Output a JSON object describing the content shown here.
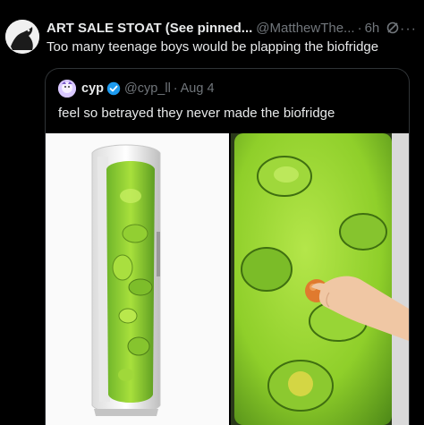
{
  "tweet": {
    "display_name": "ART SALE STOAT (See pinned...",
    "handle": "@MatthewThe...",
    "separator": "·",
    "time": "6h",
    "text": "Too many teenage boys would be plapping the biofridge",
    "more": "···"
  },
  "quoted": {
    "display_name": "cyp",
    "handle": "@cyp_ll",
    "separator": "·",
    "date": "Aug 4",
    "text": "feel so betrayed they never made the biofridge",
    "images": [
      "biofridge-product-photo",
      "biofridge-hand-photo"
    ]
  },
  "colors": {
    "background": "#000000",
    "text": "#e7e9ea",
    "muted": "#71767b",
    "border": "#2f3336",
    "verified": "#1d9bf0",
    "gel_green": "#8fcf2a"
  }
}
